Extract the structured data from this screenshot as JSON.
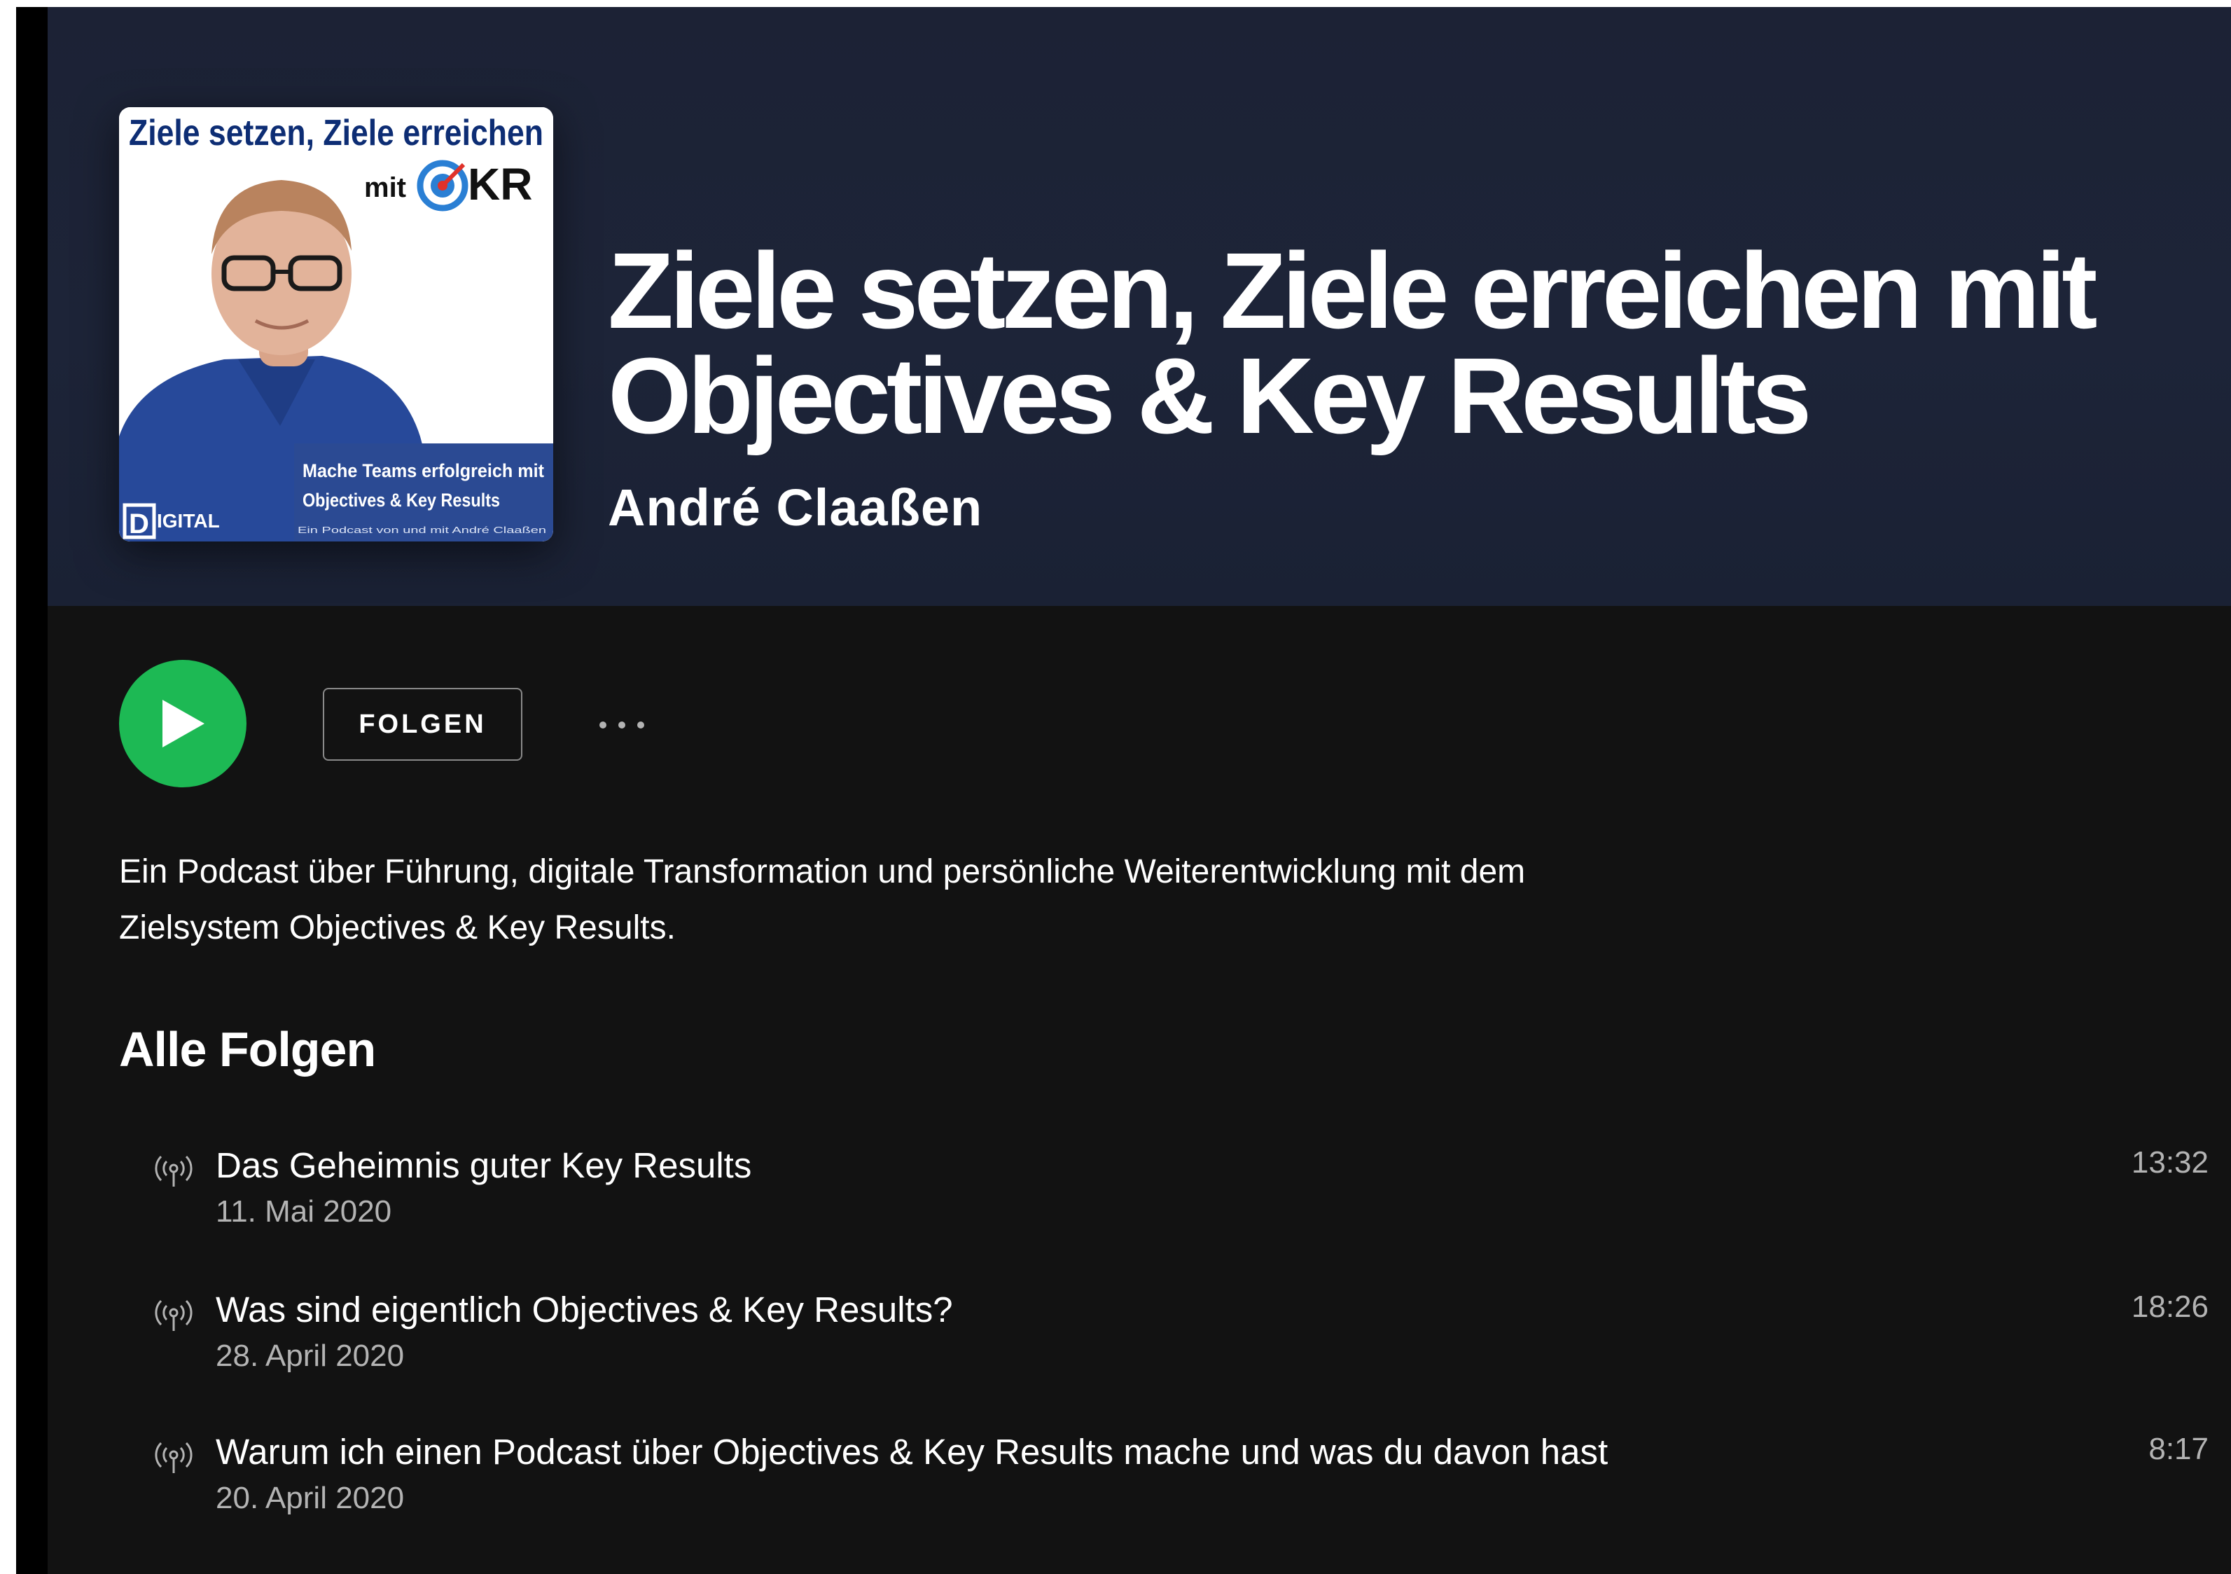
{
  "podcast": {
    "title": "Ziele setzen, Ziele erreichen mit Objectives & Key Results",
    "author": "André Claaßen",
    "description": "Ein Podcast über Führung, digitale Transformation und persönliche Weiterentwicklung mit dem Zielsystem Objectives & Key Results."
  },
  "cover": {
    "line1": "Ziele setzen, Ziele erreichen",
    "line2_prefix": "mit",
    "line2_suffix": "KR",
    "banner_line1": "Mache Teams erfolgreich mit",
    "banner_line2": "Objectives & Key Results",
    "banner_line3": "Ein Podcast von und mit André Claaßen",
    "logo_letter": "D",
    "logo_text": "IGITAL"
  },
  "actions": {
    "follow_label": "FOLGEN"
  },
  "section": {
    "heading": "Alle Folgen"
  },
  "episodes": [
    {
      "title": "Das Geheimnis guter Key Results",
      "date": "11. Mai 2020",
      "duration": "13:32"
    },
    {
      "title": "Was sind eigentlich Objectives & Key Results?",
      "date": "28. April 2020",
      "duration": "18:26"
    },
    {
      "title": "Warum ich einen Podcast über Objectives & Key Results mache und was du davon hast",
      "date": "20. April 2020",
      "duration": "8:17"
    }
  ],
  "colors": {
    "accent": "#1db954",
    "background": "#121212",
    "header": "#1d2438",
    "cover_title": "#0d2d74",
    "cover_banner": "#2b4a93"
  },
  "icons": {
    "play": "play-icon",
    "more": "more-dots-icon",
    "episode": "podcast-broadcast-icon"
  }
}
